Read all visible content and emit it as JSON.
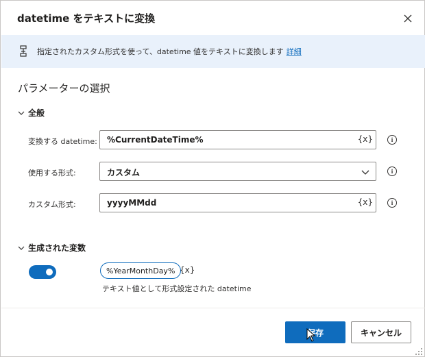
{
  "dialog": {
    "title": "datetime をテキストに変換",
    "close_icon": "close-icon"
  },
  "banner": {
    "icon": "variable-flow-icon",
    "text": "指定されたカスタム形式を使って、datetime 値をテキストに変換します",
    "link": "詳細"
  },
  "section_title": "パラメーターの選択",
  "general": {
    "header": "全般",
    "fields": [
      {
        "label": "変換する datetime:",
        "value": "%CurrentDateTime%",
        "suffix": "{x}"
      },
      {
        "label": "使用する形式:",
        "value": "カスタム"
      },
      {
        "label": "カスタム形式:",
        "value": "yyyyMMdd",
        "suffix": "{x}"
      }
    ]
  },
  "produced": {
    "header": "生成された変数",
    "toggle_on": true,
    "variable": "%YearMonthDay%",
    "suffix": "{x}",
    "description": "テキスト値として形式設定された datetime"
  },
  "footer": {
    "save_label": "保存",
    "cancel_label": "キャンセル"
  },
  "colors": {
    "accent": "#0f6cbd",
    "banner_bg": "#e9f1fb"
  }
}
